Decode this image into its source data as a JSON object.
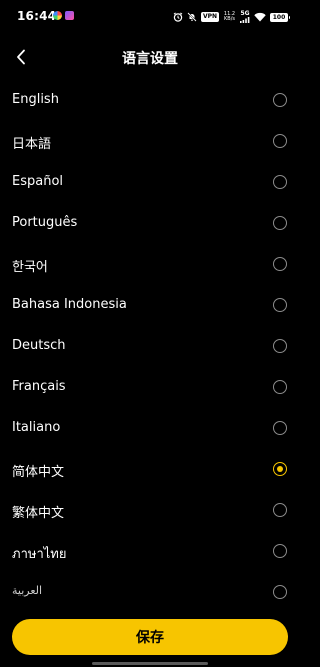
{
  "status_bar": {
    "time": "16:44",
    "vpn": "VPN",
    "net_speed_value": "11.2",
    "net_speed_unit": "KB/s",
    "network": "5G",
    "battery": "100"
  },
  "header": {
    "title": "语言设置"
  },
  "languages": [
    {
      "label": "English",
      "selected": false
    },
    {
      "label": "日本語",
      "selected": false
    },
    {
      "label": "Español",
      "selected": false
    },
    {
      "label": "Português",
      "selected": false
    },
    {
      "label": "한국어",
      "selected": false
    },
    {
      "label": "Bahasa Indonesia",
      "selected": false
    },
    {
      "label": "Deutsch",
      "selected": false
    },
    {
      "label": "Français",
      "selected": false
    },
    {
      "label": "Italiano",
      "selected": false
    },
    {
      "label": "简体中文",
      "selected": true
    },
    {
      "label": "繁体中文",
      "selected": false
    },
    {
      "label": "ภาษาไทย",
      "selected": false
    },
    {
      "label": "العربية",
      "selected": false
    }
  ],
  "save_label": "保存",
  "colors": {
    "accent": "#f7c500",
    "background": "#000000"
  }
}
